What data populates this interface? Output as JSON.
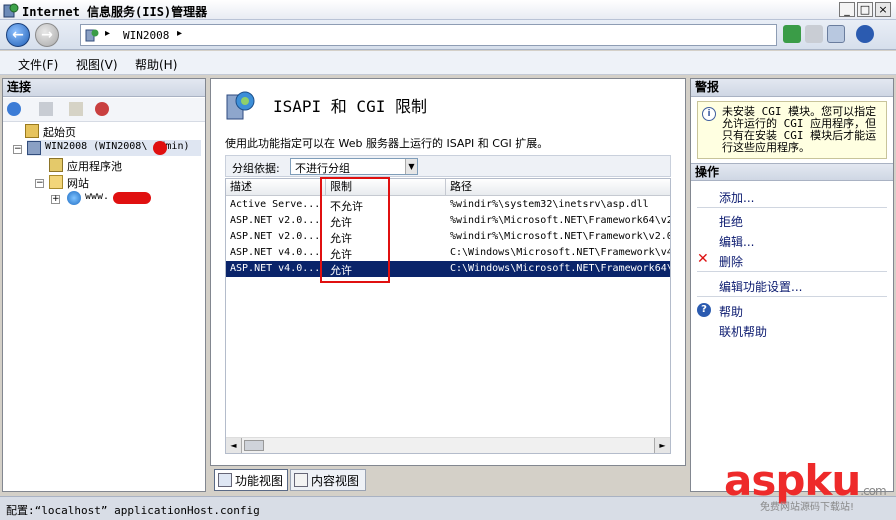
{
  "window": {
    "title": "Internet 信息服务(IIS)管理器",
    "buttons": {
      "minimize": "_",
      "maximize": "□",
      "close": "×"
    }
  },
  "address": {
    "separator": "▸",
    "crumb": "WIN2008",
    "trailing_sep": "▸"
  },
  "toolbar_icons": [
    "refresh-icon",
    "stop-icon",
    "home-icon",
    "help-icon"
  ],
  "menu": [
    "文件(F)",
    "视图(V)",
    "帮助(H)"
  ],
  "connections": {
    "header": "连接",
    "tree": [
      {
        "label": "起始页",
        "icon": "start-page-icon",
        "level": 1
      },
      {
        "label": "WIN2008 (WIN2008\\ Admin)",
        "icon": "server-icon",
        "level": 0,
        "expander": "−"
      },
      {
        "label": "应用程序池",
        "icon": "app-pool-icon",
        "level": 2
      },
      {
        "label": "网站",
        "icon": "folder-icon",
        "level": 2,
        "expander": "−"
      },
      {
        "label": "www.        com",
        "icon": "globe-icon",
        "level": 3,
        "expander": "+"
      }
    ]
  },
  "feature": {
    "title": "ISAPI 和 CGI 限制",
    "description": "使用此功能指定可以在 Web 服务器上运行的 ISAPI 和 CGI 扩展。",
    "group_label": "分组依据:",
    "group_value": "不进行分组",
    "columns": [
      "描述",
      "限制",
      "路径"
    ],
    "rows": [
      {
        "desc": "Active Serve...",
        "restriction": "不允许",
        "path": "%windir%\\system32\\inetsrv\\asp.dll",
        "selected": false
      },
      {
        "desc": "ASP.NET v2.0...",
        "restriction": "允许",
        "path": "%windir%\\Microsoft.NET\\Framework64\\v2",
        "selected": false
      },
      {
        "desc": "ASP.NET v2.0...",
        "restriction": "允许",
        "path": "%windir%\\Microsoft.NET\\Framework\\v2.0",
        "selected": false
      },
      {
        "desc": "ASP.NET v4.0...",
        "restriction": "允许",
        "path": "C:\\Windows\\Microsoft.NET\\Framework\\v4",
        "selected": false
      },
      {
        "desc": "ASP.NET v4.0...",
        "restriction": "允许",
        "path": "C:\\Windows\\Microsoft.NET\\Framework64\\",
        "selected": true
      }
    ],
    "scroll_left": "◄",
    "scroll_right": "►"
  },
  "view_tabs": [
    "功能视图",
    "内容视图"
  ],
  "right": {
    "header": "警报",
    "alert": "未安装 CGI 模块。您可以指定允许运行的 CGI 应用程序，但只有在安装 CGI 模块后才能运行这些应用程序。",
    "actions_header": "操作",
    "actions": [
      {
        "label": "添加...",
        "icon": ""
      },
      {
        "label": "拒绝",
        "icon": ""
      },
      {
        "label": "编辑...",
        "icon": ""
      },
      {
        "label": "删除",
        "icon": "delete-icon"
      },
      {
        "label": "编辑功能设置...",
        "icon": ""
      },
      {
        "label": "帮助",
        "icon": "help-icon"
      },
      {
        "label": "联机帮助",
        "icon": ""
      }
    ]
  },
  "status": "配置:“localhost” applicationHost.config",
  "watermark": {
    "text": "asp",
    "text2": "ku",
    "suffix": ".com",
    "caption": "免费网站源码下载站!"
  }
}
